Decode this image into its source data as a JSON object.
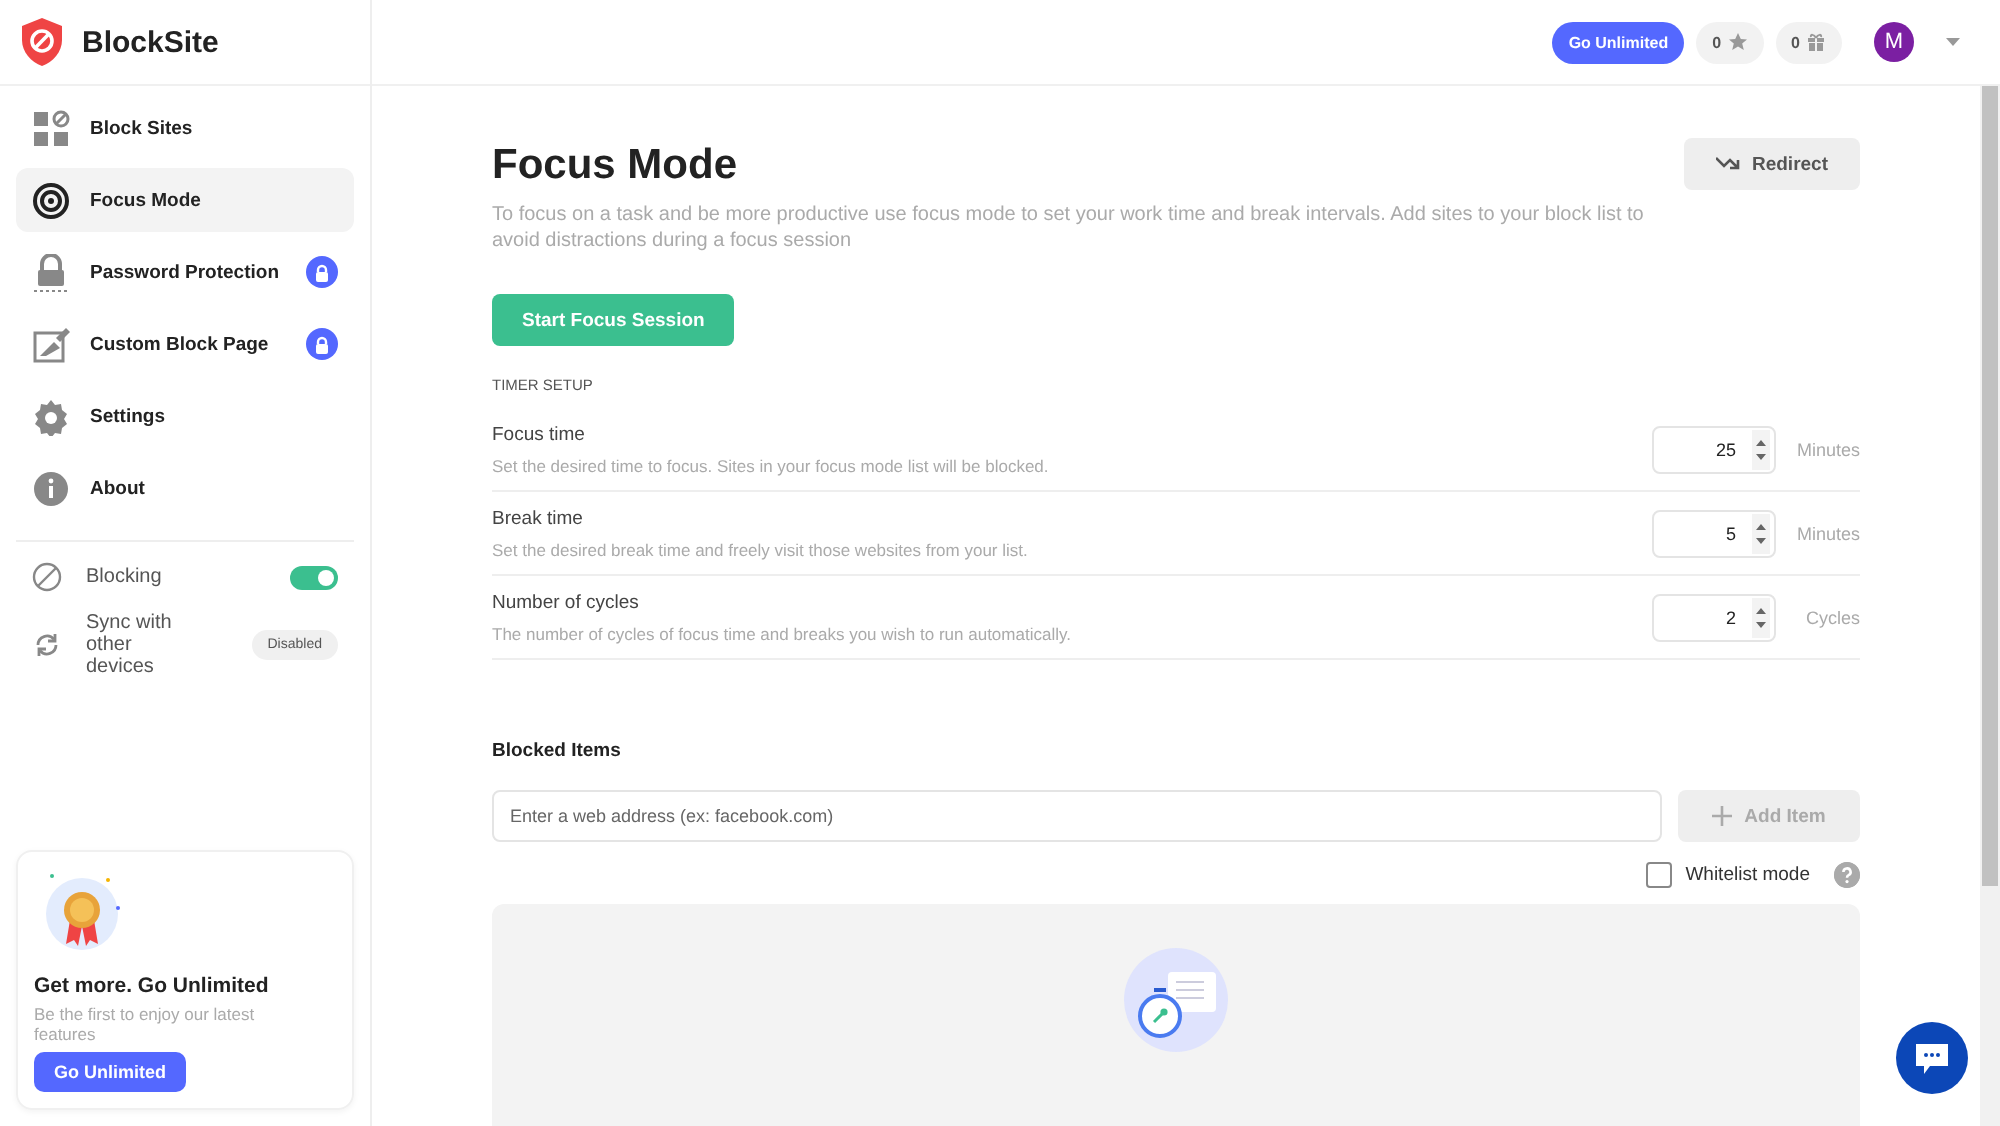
{
  "app": {
    "name": "BlockSite"
  },
  "sidebar": {
    "items": [
      {
        "label": "Block Sites",
        "selected": false,
        "locked": false
      },
      {
        "label": "Focus Mode",
        "selected": true,
        "locked": false
      },
      {
        "label": "Password Protection",
        "selected": false,
        "locked": true
      },
      {
        "label": "Custom Block Page",
        "selected": false,
        "locked": true
      },
      {
        "label": "Settings",
        "selected": false,
        "locked": false
      },
      {
        "label": "About",
        "selected": false,
        "locked": false
      }
    ],
    "blocking": {
      "label": "Blocking",
      "on": true
    },
    "sync": {
      "label": "Sync with other devices",
      "status": "Disabled"
    },
    "promo": {
      "title": "Get more. Go Unlimited",
      "text": "Be the first to enjoy our latest features",
      "button": "Go Unlimited"
    }
  },
  "header": {
    "upgrade_button": "Go Unlimited",
    "stars": "0",
    "gifts": "0",
    "avatar": "M"
  },
  "page": {
    "title": "Focus Mode",
    "description": "To focus on a task and be more productive use focus mode to set your work time and break intervals. Add sites to your block list to avoid distractions during a focus session",
    "redirect_button": "Redirect",
    "start_button": "Start Focus Session",
    "timer_heading": "TIMER SETUP",
    "settings": [
      {
        "label": "Focus time",
        "description": "Set the desired time to focus. Sites in your focus mode list will be blocked.",
        "value": "25",
        "unit": "Minutes"
      },
      {
        "label": "Break time",
        "description": "Set the desired break time and freely visit those websites from your list.",
        "value": "5",
        "unit": "Minutes"
      },
      {
        "label": "Number of cycles",
        "description": "The number of cycles of focus time and breaks you wish to run automatically.",
        "value": "2",
        "unit": "Cycles"
      }
    ],
    "blocked_heading": "Blocked Items",
    "address_field": {
      "placeholder": "Enter a web address (ex: facebook.com)"
    },
    "add_button": "Add Item",
    "whitelist": {
      "label": "Whitelist mode",
      "checked": false
    }
  }
}
